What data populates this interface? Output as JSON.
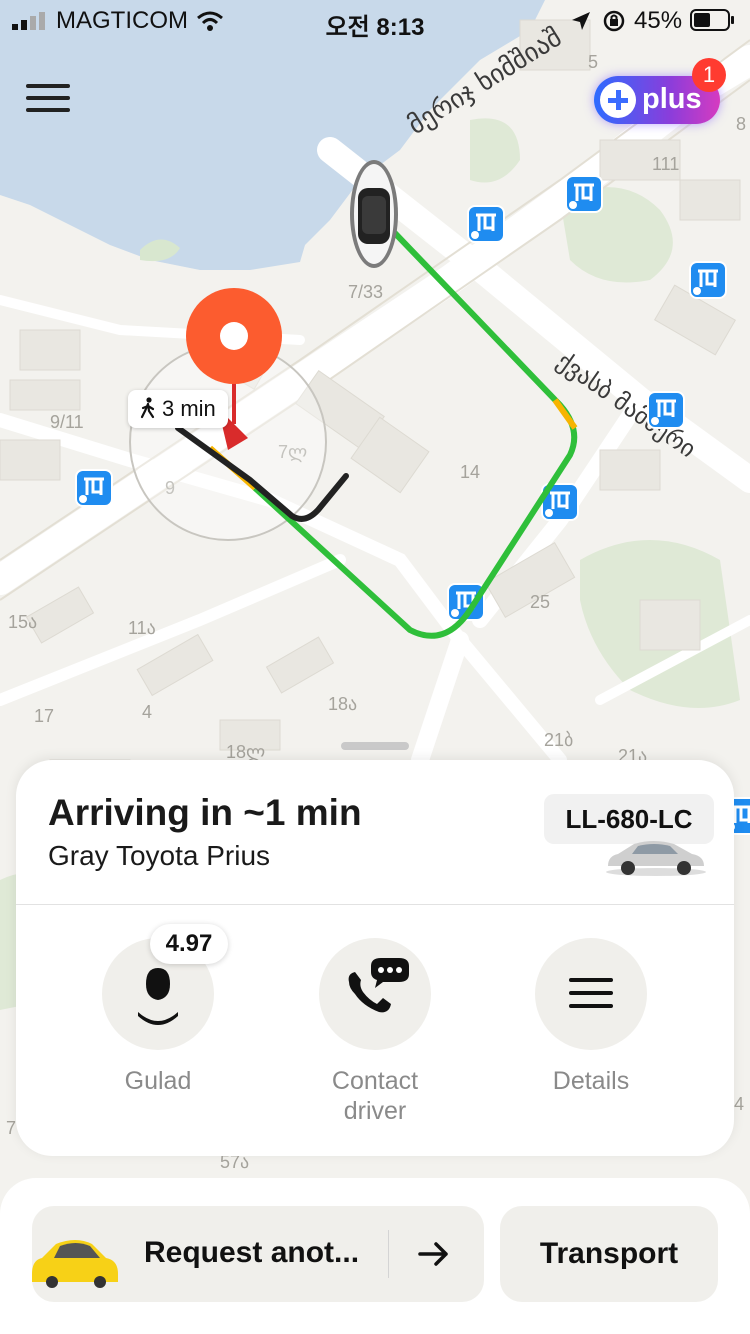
{
  "status_bar": {
    "carrier": "MAGTICOM",
    "time": "오전 8:13",
    "battery": "45%"
  },
  "plus": {
    "label": "plus",
    "notification_count": "1"
  },
  "map": {
    "streets": [
      "მერიჯ ხიმშიაშ",
      "ქვასბ მამმერი"
    ],
    "house_numbers": [
      "5",
      "8",
      "111",
      "7/33",
      "9/11",
      "9",
      "7ლ",
      "14",
      "25",
      "15ა",
      "11ა",
      "17",
      "4",
      "18ა",
      "18ლ",
      "21ბ",
      "21ა",
      "7",
      "57ა",
      "4"
    ],
    "walk_time": "3 min"
  },
  "ride": {
    "title": "Arriving in ~1 min",
    "car": "Gray Toyota Prius",
    "plate": "LL-680-LC",
    "driver_rating": "4.97",
    "actions": [
      {
        "label": "Gulad",
        "icon": "driver-icon"
      },
      {
        "label": "Contact driver",
        "icon": "phone-chat-icon"
      },
      {
        "label": "Details",
        "icon": "menu-lines-icon"
      }
    ]
  },
  "bottom": {
    "request_label": "Request anot...",
    "transport_label": "Transport"
  },
  "colors": {
    "route_green": "#2fbf3a",
    "route_yellow": "#f6b400",
    "pin_orange": "#fc5c2f",
    "bus_blue": "#1f8cf0"
  }
}
